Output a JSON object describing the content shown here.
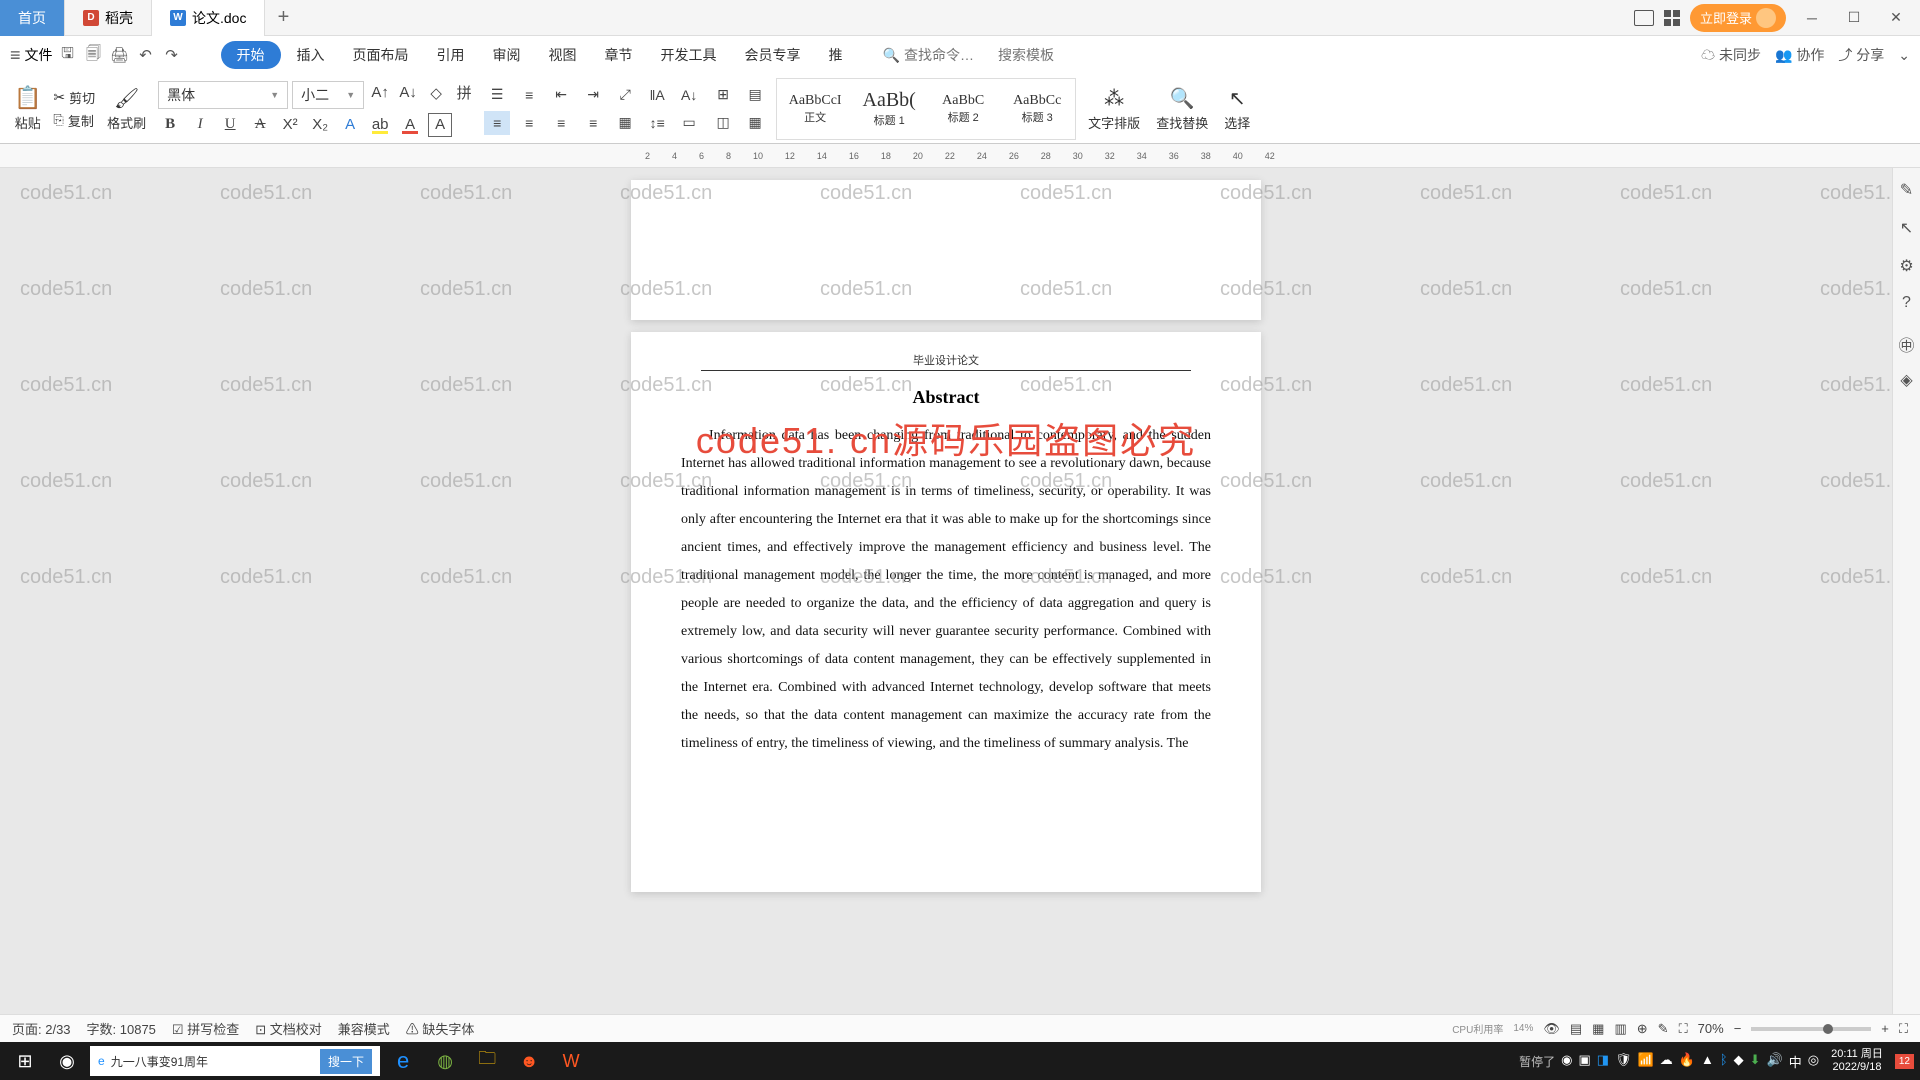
{
  "tabs": {
    "home": "首页",
    "daoke": "稻壳",
    "doc": "论文.doc",
    "plus": "+"
  },
  "topright": {
    "login": "立即登录"
  },
  "menubar": {
    "file": "文件",
    "items": [
      "开始",
      "插入",
      "页面布局",
      "引用",
      "审阅",
      "视图",
      "章节",
      "开发工具",
      "会员专享",
      "推"
    ],
    "searchcmd_ph": "查找命令…",
    "searchtpl_ph": "搜索模板",
    "nosync": "未同步",
    "coop": "协作",
    "share": "分享"
  },
  "ribbon": {
    "paste": "粘贴",
    "cut": "剪切",
    "copy": "复制",
    "format_painter": "格式刷",
    "font_name": "黑体",
    "font_size": "小二",
    "styles": {
      "normal_prev": "AaBbCcI",
      "normal": "正文",
      "h1_prev": "AaBb(",
      "h1": "标题 1",
      "h2_prev": "AaBbC",
      "h2": "标题 2",
      "h3_prev": "AaBbCc",
      "h3": "标题 3"
    },
    "text_layout": "文字排版",
    "find_replace": "查找替换",
    "select": "选择"
  },
  "ruler_marks": [
    "2",
    "4",
    "6",
    "8",
    "10",
    "12",
    "14",
    "16",
    "18",
    "20",
    "22",
    "24",
    "26",
    "28",
    "30",
    "32",
    "34",
    "36",
    "38",
    "40",
    "42"
  ],
  "document": {
    "header": "毕业设计论文",
    "title": "Abstract",
    "body": "Information data has been changing from traditional to contemporary, and the sudden Internet has allowed traditional information management to see a revolutionary dawn, because traditional information management is in terms of timeliness, security, or operability. It was only after encountering the Internet era that it was able to make up for the shortcomings since ancient times, and effectively improve the management efficiency and business level. The traditional management model, the longer the time, the more content is managed, and more people are needed to organize the data, and the efficiency of data aggregation and query is extremely low, and data security will never guarantee security performance. Combined with various shortcomings of data content management, they can be effectively supplemented in the Internet era. Combined with advanced Internet technology, develop software that meets the needs, so that the data content management can maximize the accuracy rate from the timeliness of entry, the timeliness of viewing, and the timeliness of summary analysis. The"
  },
  "watermark_text": "code51.cn",
  "watermark_red": "code51. cn源码乐园盗图必究",
  "status": {
    "page": "页面: 2/33",
    "words": "字数: 10875",
    "spell": "拼写检查",
    "proof": "文档校对",
    "compat": "兼容模式",
    "missing_font": "缺失字体",
    "zoom": "70%",
    "cpu": "CPU利用率",
    "cpu_val": "14%"
  },
  "taskbar": {
    "news": "九一八事变91周年",
    "search_ph": "",
    "search_btn": "搜一下",
    "pause": "暂停了",
    "ime": "中",
    "time": "20:11 周日",
    "date": "2022/9/18",
    "notif": "12"
  }
}
